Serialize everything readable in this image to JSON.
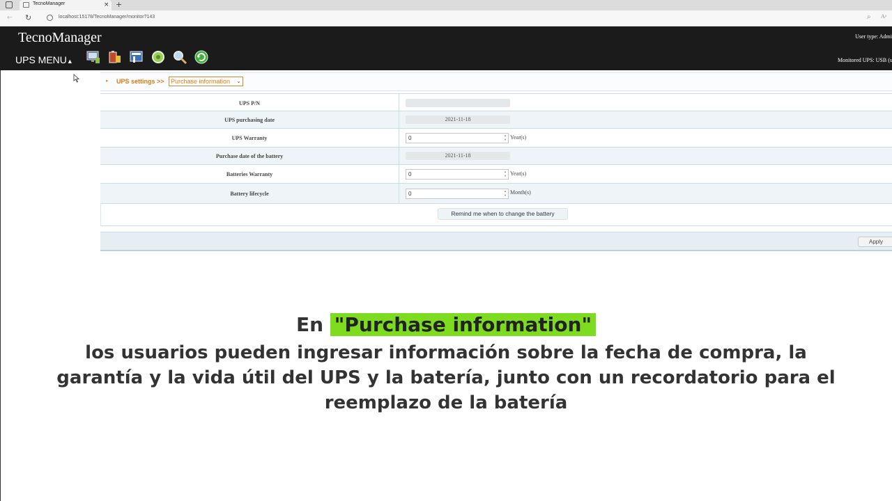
{
  "browser": {
    "tab_title": "TecnoManager",
    "tab_close": "×",
    "new_tab": "+",
    "url": "localhost:15178/TecnoManager/monitor?143"
  },
  "header": {
    "brand": "TecnoManager",
    "user_type": "User type: Admi",
    "monitored_ups": "Monitored UPS: USB (s",
    "ups_menu_label": "UPS MENU",
    "ups_menu_arrow": "▲",
    "toolbar_icons": [
      "monitor-icon",
      "battery-icon",
      "config-icon",
      "status-icon",
      "search-icon",
      "refresh-icon"
    ]
  },
  "settings": {
    "label": "UPS settings >>",
    "selected_section": "Purchase information"
  },
  "form": {
    "rows": [
      {
        "label": "UPS P/N",
        "value": "",
        "unit": ""
      },
      {
        "label": "UPS purchasing date",
        "value": "2021-11-18",
        "unit": ""
      },
      {
        "label": "UPS Warranty",
        "value": "0",
        "unit": "Year(s)"
      },
      {
        "label": "Purchase date of the battery",
        "value": "2021-11-18",
        "unit": ""
      },
      {
        "label": "Batteries Warranty",
        "value": "0",
        "unit": "Year(s)"
      },
      {
        "label": "Battery lifecycle",
        "value": "0",
        "unit": "Month(s)"
      }
    ],
    "remind_button": "Remind me when to change the battery",
    "apply_button": "Apply"
  },
  "subtitle": {
    "prefix": "En",
    "highlight": "\"Purchase information\"",
    "body": "los usuarios pueden ingresar información sobre la fecha de compra, la garantía y la vida útil del UPS y la batería, junto con un recordatorio para el reemplazo de la batería"
  },
  "colors": {
    "header_bg": "#1b1b1b",
    "accent_orange": "#e07a14",
    "highlight_green": "#7ddc1f"
  }
}
